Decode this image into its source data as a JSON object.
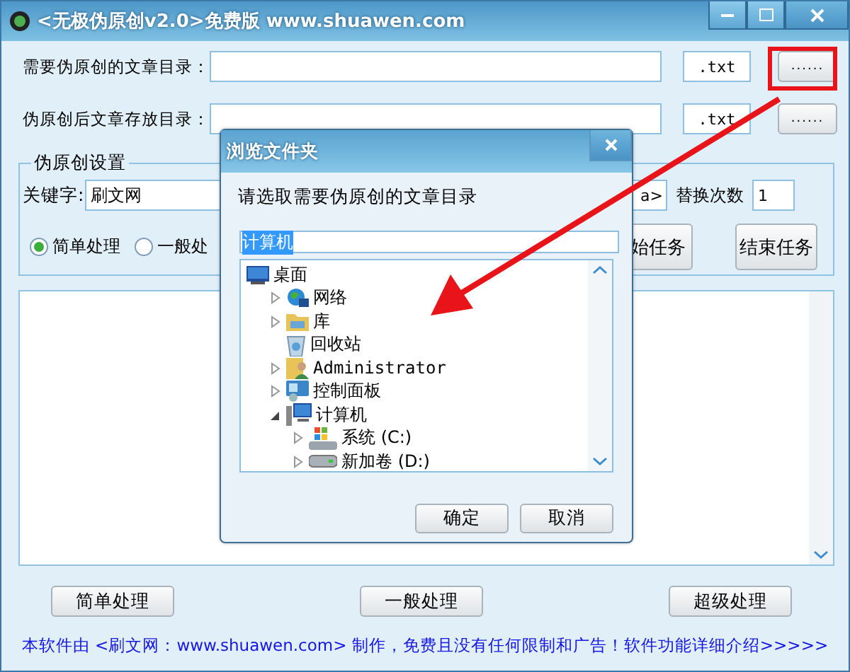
{
  "window": {
    "title": "<无极伪原创v2.0>免费版 www.shuawen.com"
  },
  "paths": [
    {
      "label": "需要伪原创的文章目录：",
      "ext": ".txt",
      "browse": "......"
    },
    {
      "label": "伪原创后文章存放目录：",
      "ext": ".txt",
      "browse": "......"
    }
  ],
  "settings": {
    "title": "伪原创设置",
    "keyword_label": "关键字:",
    "keyword": "刷文网",
    "field_2": "a>",
    "replace_label": "替换次数",
    "replace_count": "1",
    "modes": [
      {
        "label": "简单处理",
        "selected": true
      },
      {
        "label": "一般处",
        "selected": false
      }
    ],
    "start_button": "始任务",
    "stop_button": "结束任务"
  },
  "actions": [
    "简单处理",
    "一般处理",
    "超级处理"
  ],
  "footer": "本软件由 <刷文网：www.shuawen.com> 制作，免费且没有任何限制和广告！软件功能详细介绍>>>>>",
  "dialog": {
    "title": "浏览文件夹",
    "prompt": "请选取需要伪原创的文章目录",
    "path": "计算机",
    "tree": [
      {
        "label": "桌面",
        "kind": "monitor",
        "children": [
          {
            "label": "网络",
            "kind": "network",
            "expanded": false
          },
          {
            "label": "库",
            "kind": "folder",
            "expanded": false
          },
          {
            "label": "回收站",
            "kind": "recycle"
          },
          {
            "label": "Administrator",
            "kind": "user",
            "expanded": false
          },
          {
            "label": "控制面板",
            "kind": "control",
            "expanded": false
          },
          {
            "label": "计算机",
            "kind": "computer",
            "expanded": true,
            "children": [
              {
                "label": "系统 (C:)",
                "kind": "system-drive",
                "expanded": false
              },
              {
                "label": "新加卷 (D:)",
                "kind": "drive",
                "expanded": false
              }
            ]
          }
        ]
      }
    ],
    "buttons": [
      "确定",
      "取消"
    ]
  }
}
